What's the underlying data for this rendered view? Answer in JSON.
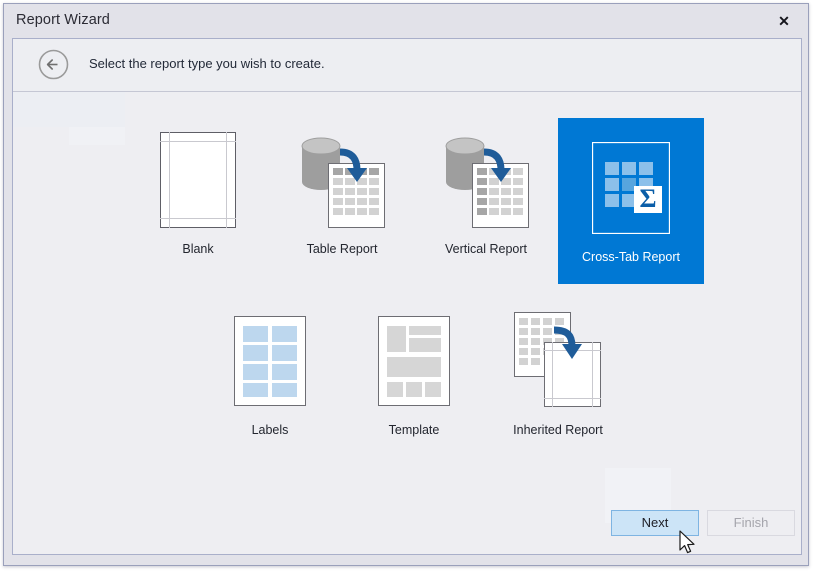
{
  "window": {
    "title": "Report Wizard",
    "close_icon": "close-icon",
    "close_label": "✕"
  },
  "header": {
    "back_icon": "circled-back-arrow-icon",
    "caption": "Select the report type you wish to create."
  },
  "report_types": [
    {
      "id": "blank",
      "label": "Blank",
      "icon": "blank-page-icon",
      "selected": false
    },
    {
      "id": "table",
      "label": "Table Report",
      "icon": "database-to-table-icon",
      "selected": false
    },
    {
      "id": "vertical",
      "label": "Vertical Report",
      "icon": "database-to-vertical-icon",
      "selected": false
    },
    {
      "id": "crosstab",
      "label": "Cross-Tab Report",
      "icon": "cross-tab-sigma-icon",
      "selected": true
    },
    {
      "id": "labels",
      "label": "Labels",
      "icon": "labels-grid-icon",
      "selected": false
    },
    {
      "id": "template",
      "label": "Template",
      "icon": "template-layout-icon",
      "selected": false
    },
    {
      "id": "inherited",
      "label": "Inherited Report",
      "icon": "inherited-report-icon",
      "selected": false
    }
  ],
  "footer": {
    "next_label": "Next",
    "finish_label": "Finish",
    "finish_enabled": false,
    "next_state": "hover"
  },
  "colors": {
    "accent_selected": "#0078d4",
    "window_chrome": "#e2e2e9",
    "panel_background": "#eeeef2",
    "button_hover": "#cce4f7",
    "arrow_blue": "#1f5c99",
    "cell_gray": "#d2d2d2",
    "cell_dark_gray": "#a6a6a6",
    "label_blue": "#bdd7ee"
  }
}
